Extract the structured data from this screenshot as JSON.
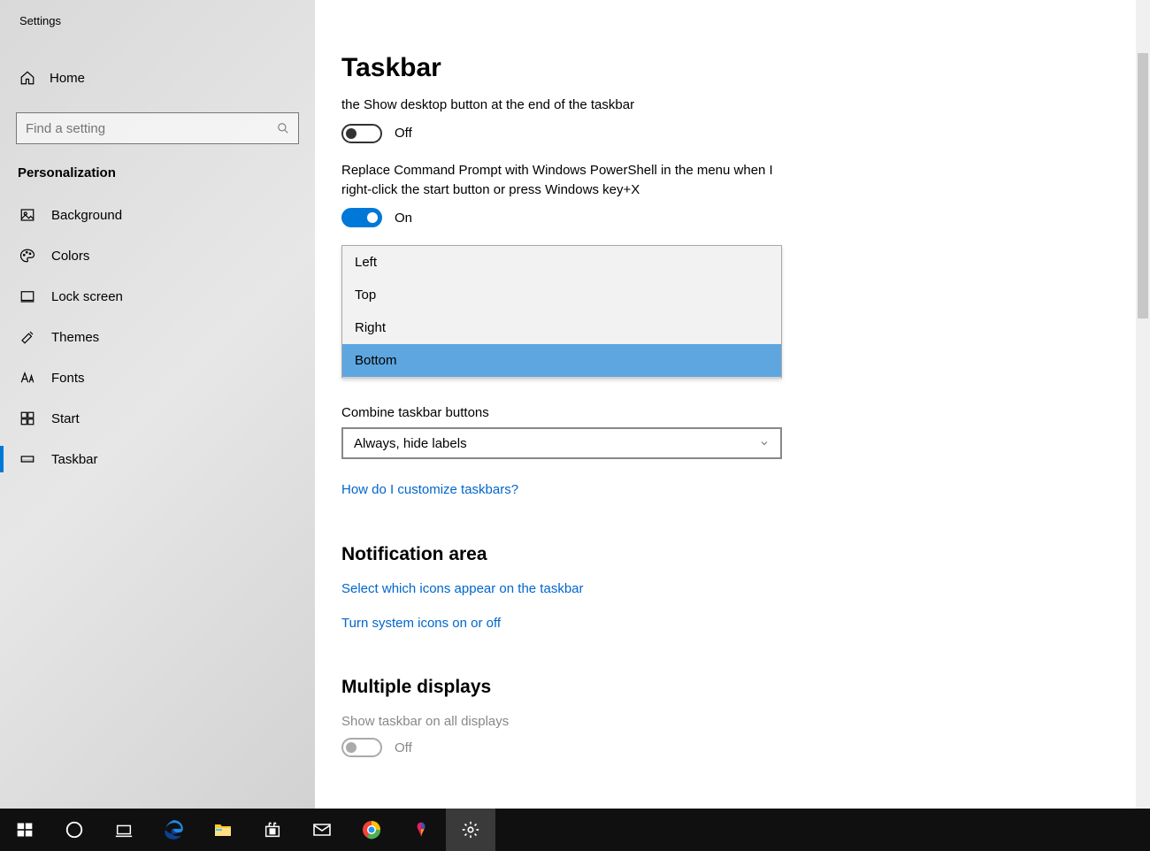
{
  "window": {
    "title": "Settings"
  },
  "sidebar": {
    "home": "Home",
    "search_placeholder": "Find a setting",
    "section": "Personalization",
    "items": [
      {
        "label": "Background",
        "icon": "image"
      },
      {
        "label": "Colors",
        "icon": "palette"
      },
      {
        "label": "Lock screen",
        "icon": "lockscreen"
      },
      {
        "label": "Themes",
        "icon": "themes"
      },
      {
        "label": "Fonts",
        "icon": "fonts"
      },
      {
        "label": "Start",
        "icon": "start"
      },
      {
        "label": "Taskbar",
        "icon": "taskbar",
        "selected": true
      }
    ]
  },
  "main": {
    "title": "Taskbar",
    "setting1": {
      "desc": "the Show desktop button at the end of the taskbar",
      "state": "Off"
    },
    "setting2": {
      "desc": "Replace Command Prompt with Windows PowerShell in the menu when I right-click the start button or press Windows key+X",
      "state": "On"
    },
    "location_dropdown": {
      "options": [
        "Left",
        "Top",
        "Right",
        "Bottom"
      ],
      "selected": "Bottom"
    },
    "combine": {
      "label": "Combine taskbar buttons",
      "value": "Always, hide labels"
    },
    "help_link": "How do I customize taskbars?",
    "notif": {
      "heading": "Notification area",
      "link1": "Select which icons appear on the taskbar",
      "link2": "Turn system icons on or off"
    },
    "multi": {
      "heading": "Multiple displays",
      "desc": "Show taskbar on all displays",
      "state": "Off"
    }
  }
}
